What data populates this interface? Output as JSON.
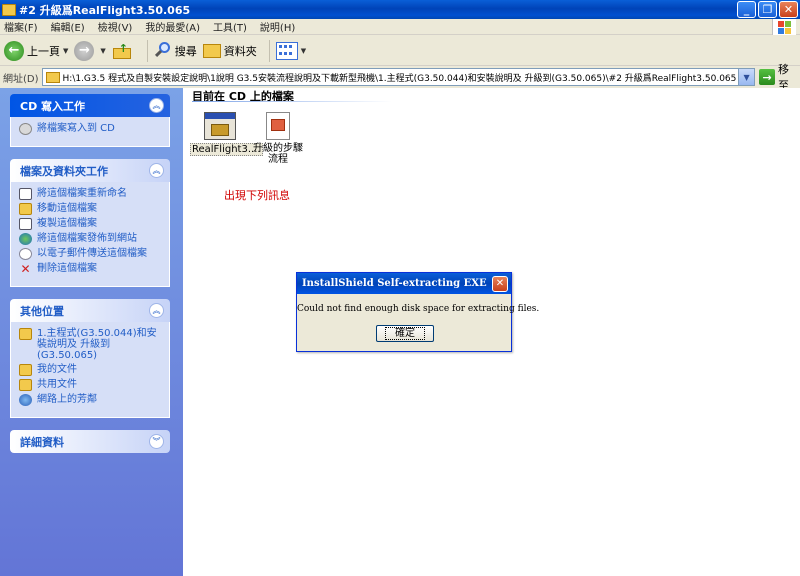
{
  "window": {
    "title": "#2 升級爲RealFlight3.50.065"
  },
  "menu": [
    "檔案(F)",
    "編輯(E)",
    "檢視(V)",
    "我的最愛(A)",
    "工具(T)",
    "說明(H)"
  ],
  "toolbar": {
    "back_label": "上一頁",
    "search_label": "搜尋",
    "folders_label": "資料夾"
  },
  "address": {
    "label": "網址(D)",
    "path": "H:\\1.G3.5 程式及自製安裝設定說明\\1說明 G3.5安裝流程說明及下載新型飛機\\1.主程式(G3.50.044)和安裝說明及 升級到(G3.50.065)\\#2 升級爲RealFlight3.50.065",
    "go_label": "移至"
  },
  "sidebar": {
    "cd_tasks": {
      "title": "CD 寫入工作",
      "items": [
        {
          "label": "將檔案寫入到 CD",
          "icon": "cd-burn-icon"
        }
      ]
    },
    "file_tasks": {
      "title": "檔案及資料夾工作",
      "items": [
        {
          "label": "將這個檔案重新命名",
          "icon": "rename-icon"
        },
        {
          "label": "移動這個檔案",
          "icon": "move-icon"
        },
        {
          "label": "複製這個檔案",
          "icon": "copy-icon"
        },
        {
          "label": "將這個檔案發佈到網站",
          "icon": "publish-web-icon"
        },
        {
          "label": "以電子郵件傳送這個檔案",
          "icon": "email-icon"
        },
        {
          "label": "刪除這個檔案",
          "icon": "delete-icon"
        }
      ]
    },
    "other_places": {
      "title": "其他位置",
      "items": [
        {
          "label": "1.主程式(G3.50.044)和安裝說明及 升級到(G3.50.065)",
          "icon": "folder-icon"
        },
        {
          "label": "我的文件",
          "icon": "my-documents-icon"
        },
        {
          "label": "共用文件",
          "icon": "shared-documents-icon"
        },
        {
          "label": "網路上的芳鄰",
          "icon": "network-icon"
        }
      ]
    },
    "details": {
      "title": "詳細資料"
    }
  },
  "content": {
    "section_title": "目前在 CD 上的檔案",
    "files": [
      {
        "label": "RealFlight3....",
        "icon": "installer-exe-icon",
        "selected": true
      },
      {
        "label": "升級的步驟流程",
        "icon": "document-icon",
        "selected": false
      }
    ],
    "note": "出現下列訊息"
  },
  "dialog": {
    "title": "InstallShield Self-extracting EXE",
    "message": "Could not find enough disk space for extracting files.",
    "ok_label": "確定"
  },
  "colors": {
    "titlebar_blue": "#0054e3",
    "taskpane_blue": "#7ba2e7",
    "link_blue": "#215dc6",
    "note_red": "#d00000"
  }
}
